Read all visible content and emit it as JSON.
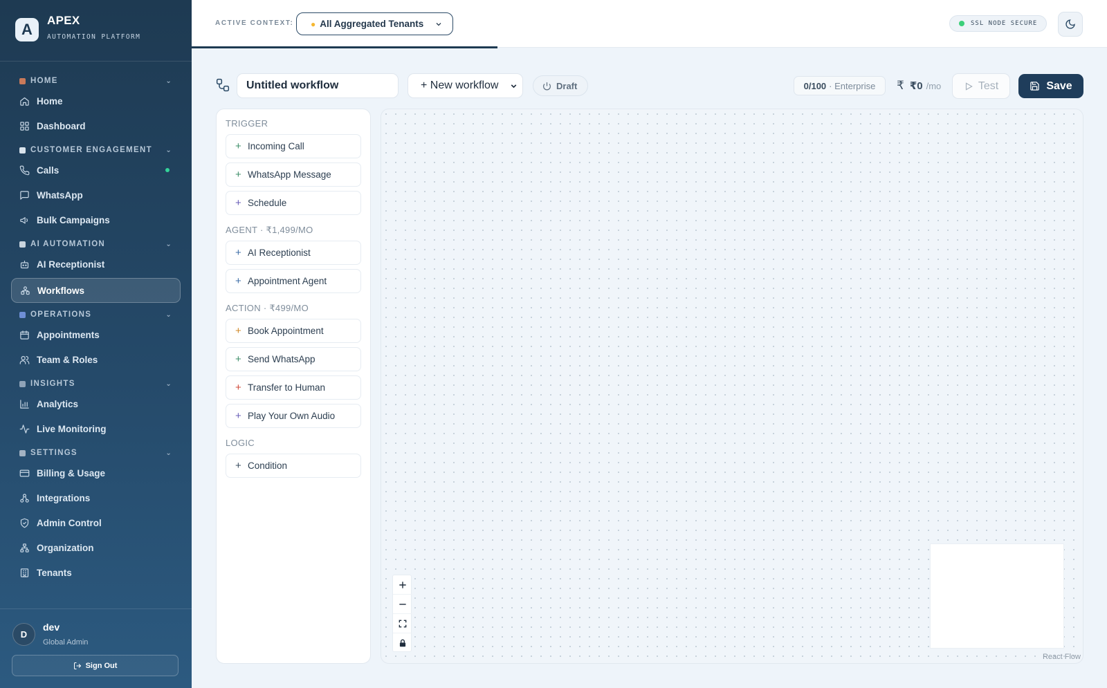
{
  "brand": {
    "logo_letter": "A",
    "name": "APEX",
    "subtitle": "AUTOMATION PLATFORM"
  },
  "sidebar": {
    "sections": [
      {
        "label": "HOME",
        "color": "#c97a5a",
        "items": [
          {
            "label": "Home",
            "icon": "home-icon"
          },
          {
            "label": "Dashboard",
            "icon": "dashboard-icon"
          }
        ]
      },
      {
        "label": "CUSTOMER ENGAGEMENT",
        "color": "#d9e3ec",
        "items": [
          {
            "label": "Calls",
            "icon": "phone-icon",
            "status_dot": true
          },
          {
            "label": "WhatsApp",
            "icon": "message-icon"
          },
          {
            "label": "Bulk Campaigns",
            "icon": "megaphone-icon"
          }
        ]
      },
      {
        "label": "AI AUTOMATION",
        "color": "#c9d4de",
        "items": [
          {
            "label": "AI Receptionist",
            "icon": "bot-icon"
          },
          {
            "label": "Workflows",
            "icon": "workflow-icon",
            "active": true
          }
        ]
      },
      {
        "label": "OPERATIONS",
        "color": "#6f8fd6",
        "items": [
          {
            "label": "Appointments",
            "icon": "calendar-icon"
          },
          {
            "label": "Team & Roles",
            "icon": "users-icon"
          }
        ]
      },
      {
        "label": "INSIGHTS",
        "color": "#8fa3b8",
        "items": [
          {
            "label": "Analytics",
            "icon": "bar-chart-icon"
          },
          {
            "label": "Live Monitoring",
            "icon": "activity-icon"
          }
        ]
      },
      {
        "label": "SETTINGS",
        "color": "#a3b2c2",
        "items": [
          {
            "label": "Billing & Usage",
            "icon": "credit-card-icon"
          },
          {
            "label": "Integrations",
            "icon": "plug-icon"
          },
          {
            "label": "Admin Control",
            "icon": "shield-icon"
          },
          {
            "label": "Organization",
            "icon": "org-icon"
          },
          {
            "label": "Tenants",
            "icon": "building-icon"
          }
        ]
      }
    ],
    "user": {
      "initial": "D",
      "name": "dev",
      "role": "Global Admin"
    },
    "sign_out": "Sign Out"
  },
  "topbar": {
    "context_label": "ACTIVE CONTEXT:",
    "context_value": "All Aggregated Tenants",
    "ssl_status": "SSL NODE SECURE"
  },
  "toolbar": {
    "workflow_name": "Untitled workflow",
    "new_workflow": "+ New workflow",
    "draft": "Draft",
    "quota_count": "0/100",
    "quota_plan": "· Enterprise",
    "cost_amount": "₹0",
    "cost_period": "/mo",
    "test_label": "Test",
    "save_label": "Save"
  },
  "palette": {
    "groups": [
      {
        "heading": "TRIGGER",
        "items": [
          {
            "label": "Incoming Call",
            "color": "#3f8f6a"
          },
          {
            "label": "WhatsApp Message",
            "color": "#3f8f6a"
          },
          {
            "label": "Schedule",
            "color": "#6a5fb8"
          }
        ]
      },
      {
        "heading": "AGENT · ₹1,499/MO",
        "items": [
          {
            "label": "AI Receptionist",
            "color": "#3f6fa8"
          },
          {
            "label": "Appointment Agent",
            "color": "#3f6fa8"
          }
        ]
      },
      {
        "heading": "ACTION · ₹499/MO",
        "items": [
          {
            "label": "Book Appointment",
            "color": "#d08a2a"
          },
          {
            "label": "Send WhatsApp",
            "color": "#3f8f6a"
          },
          {
            "label": "Transfer to Human",
            "color": "#d04a3a"
          },
          {
            "label": "Play Your Own Audio",
            "color": "#6a5fb8"
          }
        ]
      },
      {
        "heading": "LOGIC",
        "items": [
          {
            "label": "Condition",
            "color": "#3a4d5f"
          }
        ]
      }
    ]
  },
  "canvas": {
    "attribution": "React Flow"
  }
}
